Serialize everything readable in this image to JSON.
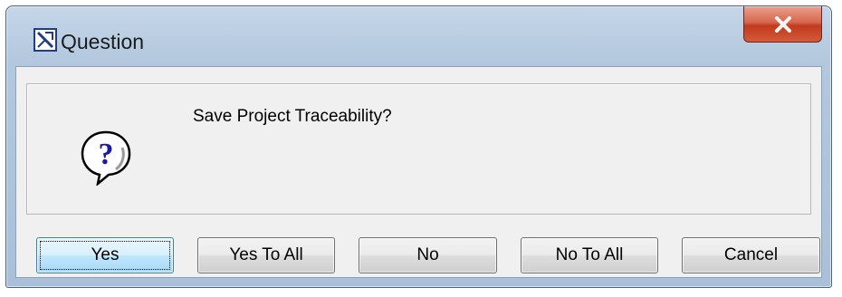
{
  "window": {
    "title": "Question",
    "app_icon": "app-icon",
    "close_icon": "close-icon"
  },
  "message": {
    "icon": "question-icon",
    "text": "Save Project Traceability?"
  },
  "buttons": [
    {
      "label": "Yes",
      "default": true
    },
    {
      "label": "Yes To All",
      "default": false
    },
    {
      "label": "No",
      "default": false
    },
    {
      "label": "No To All",
      "default": false
    },
    {
      "label": "Cancel",
      "default": false
    }
  ],
  "colors": {
    "close_button": "#c13a1d",
    "default_button_border": "#3c7fb1",
    "icon_blue": "#1a1aa8"
  }
}
